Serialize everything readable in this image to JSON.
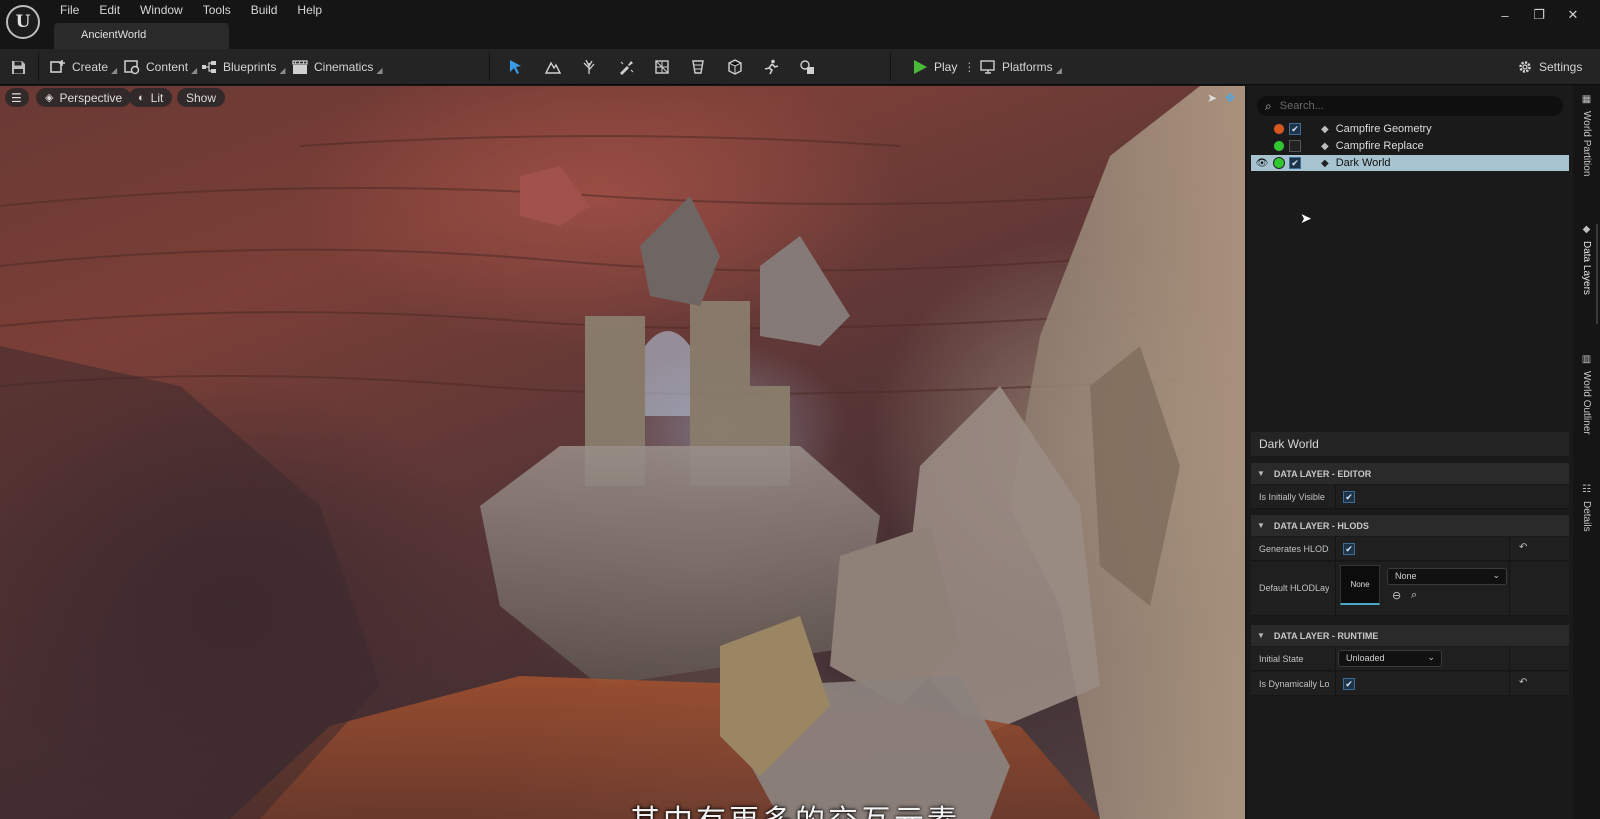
{
  "app": {
    "logo": "U",
    "menu": [
      "File",
      "Edit",
      "Window",
      "Tools",
      "Build",
      "Help"
    ],
    "project_tab": "AncientWorld",
    "window_controls": {
      "minimize": "–",
      "restore": "❐",
      "close": "✕"
    }
  },
  "toolbar": {
    "create": "Create",
    "content": "Content",
    "blueprints": "Blueprints",
    "cinematics": "Cinematics",
    "play": "Play",
    "platforms": "Platforms",
    "settings": "Settings",
    "mode_icons": [
      "select-mode-icon",
      "landscape-mode-icon",
      "foliage-mode-icon",
      "mesh-paint-mode-icon",
      "fracture-mode-icon",
      "brush-edit-mode-icon",
      "modeling-mode-icon",
      "animation-mode-icon",
      "geometry-mode-icon"
    ]
  },
  "viewport": {
    "perspective": "Perspective",
    "lit": "Lit",
    "show": "Show",
    "subtitle": "其中有更多的交互元素"
  },
  "data_layers": {
    "search_placeholder": "Search...",
    "items": [
      {
        "label": "Campfire Geometry",
        "dot_color": "#d9571f",
        "checked": true,
        "visible": false,
        "selected": false
      },
      {
        "label": "Campfire Replace",
        "dot_color": "#32c832",
        "checked": false,
        "visible": false,
        "selected": false
      },
      {
        "label": "Dark World",
        "dot_color": "#32c832",
        "checked": true,
        "visible": true,
        "selected": true
      }
    ]
  },
  "details": {
    "title": "Dark World",
    "sections": {
      "editor": "DATA LAYER - EDITOR",
      "hlods": "DATA LAYER - HLODS",
      "runtime": "DATA LAYER - RUNTIME"
    },
    "props": {
      "is_initially_visible": "Is Initially Visible",
      "generates_hlods": "Generates HLODs",
      "default_hlod_layer": "Default HLODLayer",
      "default_hlod_thumb": "None",
      "default_hlod_value": "None",
      "initial_state_label": "Initial State",
      "initial_state_value": "Unloaded",
      "is_dynamically_loaded": "Is Dynamically Loaded"
    }
  },
  "side_tabs": [
    "World Partition",
    "Data Layers",
    "World Outliner",
    "Details"
  ]
}
